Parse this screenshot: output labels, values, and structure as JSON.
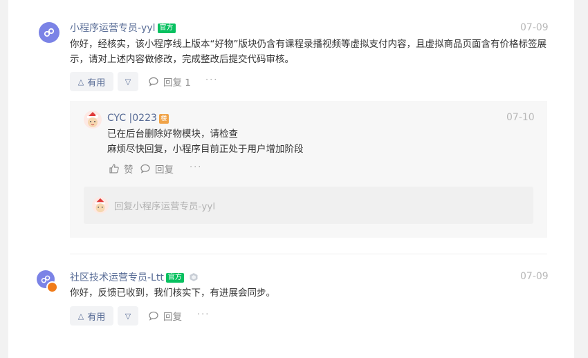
{
  "comments": [
    {
      "author": "小程序运营专员-yyl",
      "official_badge": "官方",
      "date": "07-09",
      "text": "你好，经核实，该小程序线上版本“好物”版块仍含有课程录播视频等虚拟支付内容，且虚拟商品页面含有价格标签展示，请对上述内容做修改，完成整改后提交代码审核。",
      "like_label": "有用",
      "reply_label": "回复 1",
      "more": "···"
    },
    {
      "author": "社区技术运营专员-Ltt",
      "official_badge": "官方",
      "date": "07-09",
      "text": "你好，反馈已收到，我们核实下，有进展会同步。",
      "like_label": "有用",
      "reply_label": "回复",
      "more": "···"
    }
  ],
  "sub_reply": {
    "author": "CYC |0223",
    "floor_badge": "楼",
    "date": "07-10",
    "lines": [
      "已在后台删除好物模块，请检查",
      "麻烦尽快回复，小程序目前正处于用户增加阶段"
    ],
    "like_label": "赞",
    "reply_label": "回复",
    "more": "···",
    "reply_placeholder": "回复小程序运营专员-yyl"
  },
  "colors": {
    "author": "#576b95",
    "official": "#07c160",
    "floor": "#f0a348",
    "mp_avatar": "#7b83e6"
  }
}
